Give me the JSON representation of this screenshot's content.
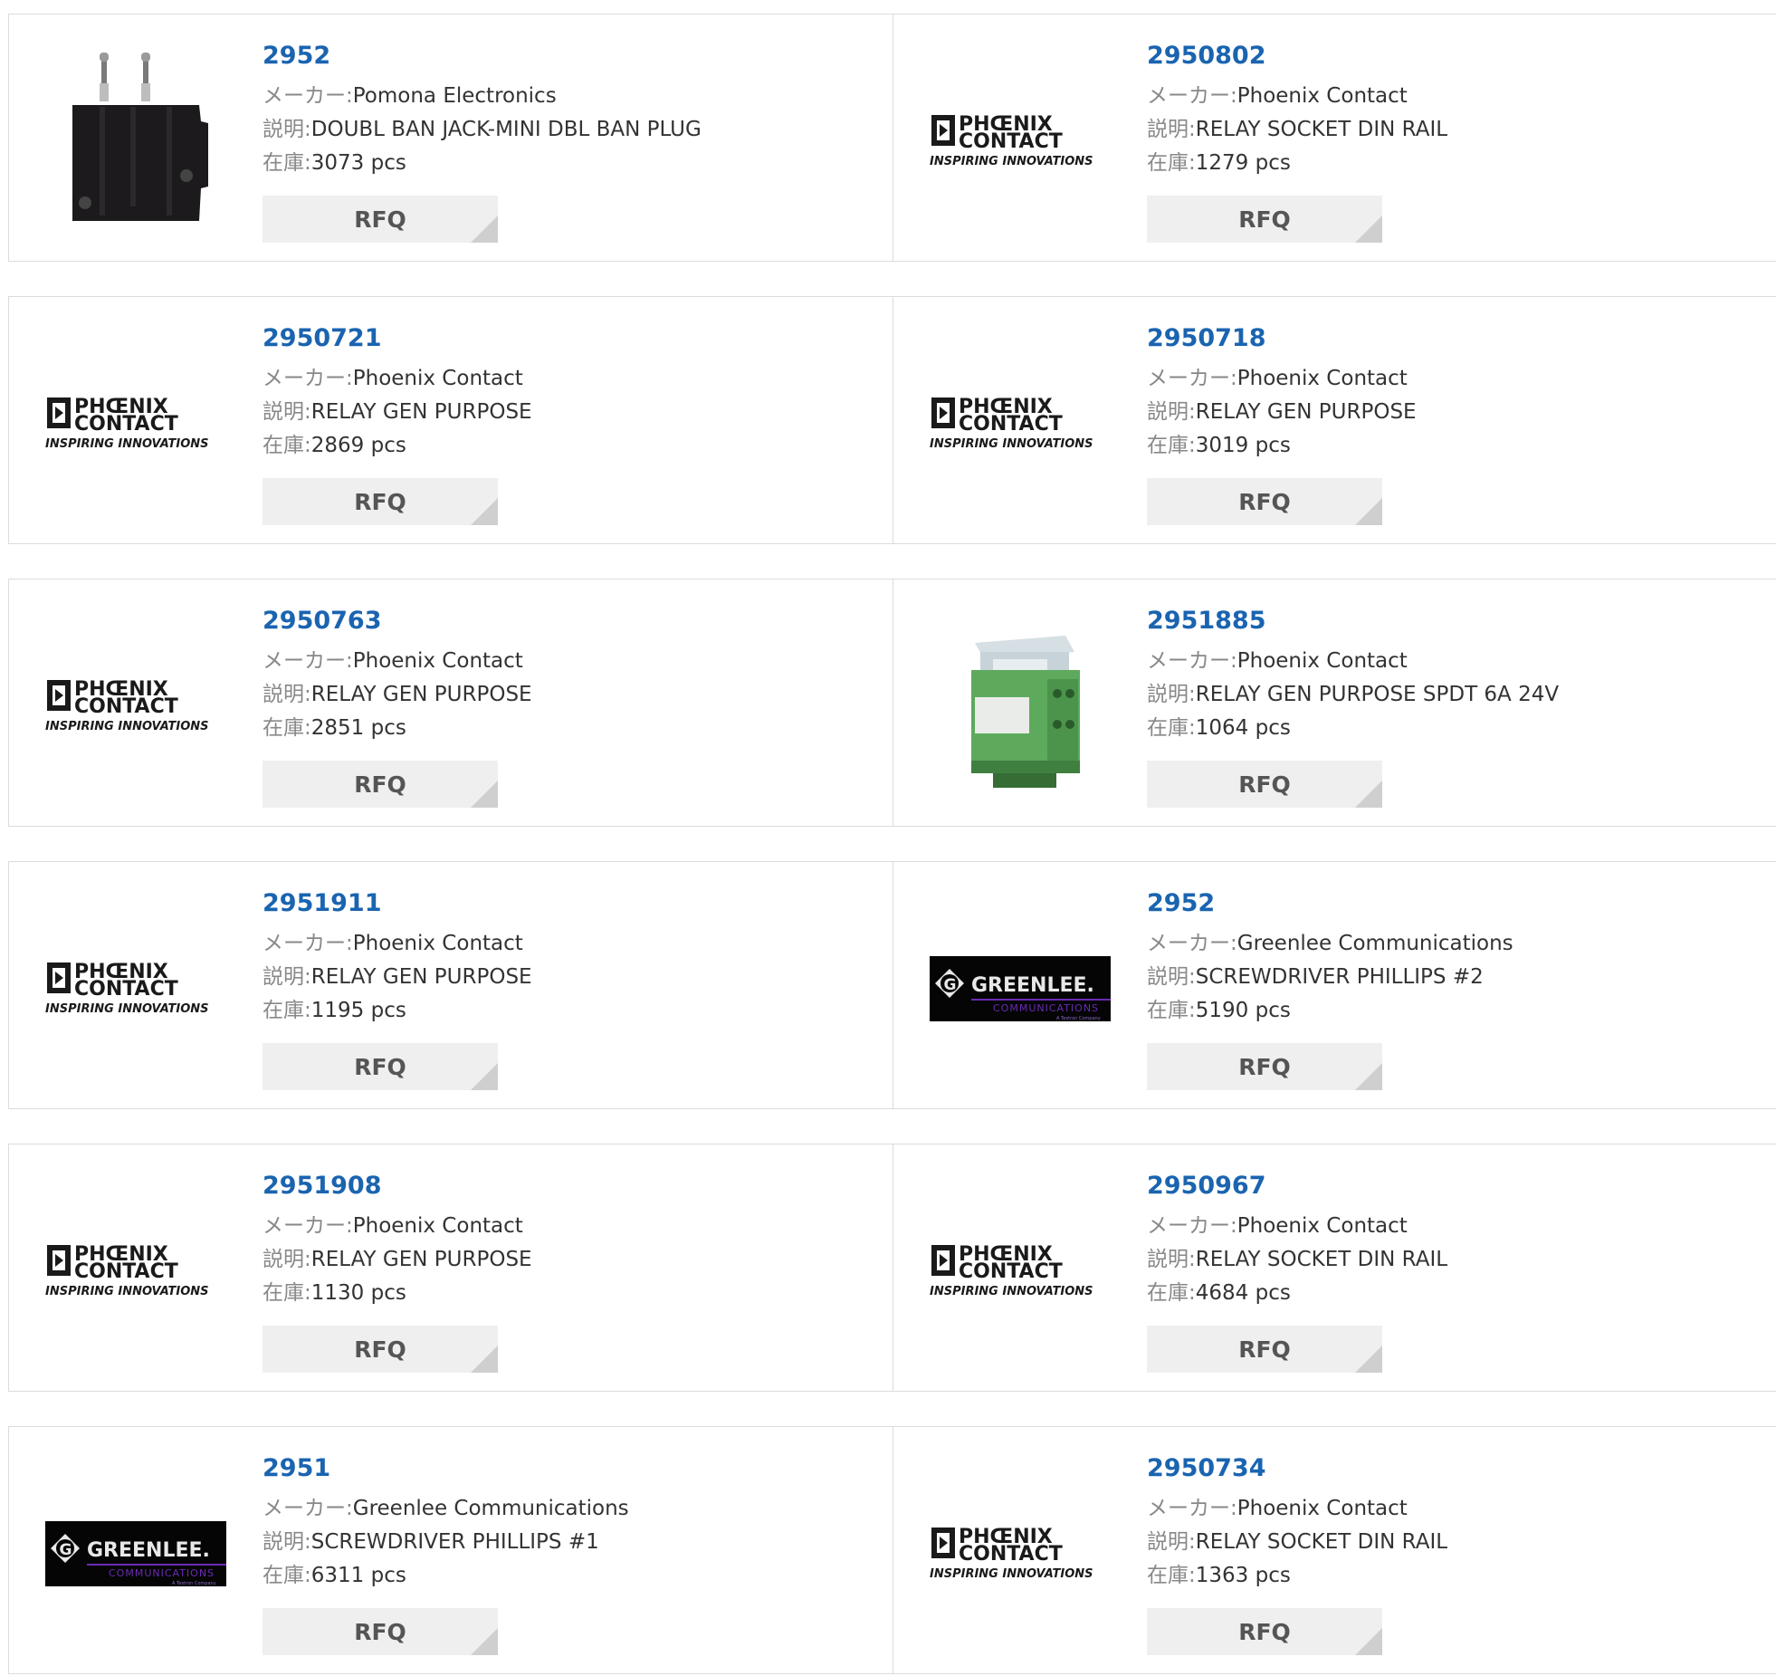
{
  "labels": {
    "maker": "メーカー:",
    "desc": "説明:",
    "stock": "在庫:",
    "rfq": "RFQ"
  },
  "products": [
    {
      "part": "2952",
      "maker": "Pomona Electronics",
      "desc": "DOUBL BAN JACK-MINI DBL BAN PLUG",
      "stock": "3073 pcs",
      "image": "banana-plug-photo"
    },
    {
      "part": "2950802",
      "maker": "Phoenix Contact",
      "desc": "RELAY SOCKET DIN RAIL",
      "stock": "1279 pcs",
      "image": "phoenix-logo"
    },
    {
      "part": "2950721",
      "maker": "Phoenix Contact",
      "desc": "RELAY GEN PURPOSE",
      "stock": "2869 pcs",
      "image": "phoenix-logo"
    },
    {
      "part": "2950718",
      "maker": "Phoenix Contact",
      "desc": "RELAY GEN PURPOSE",
      "stock": "3019 pcs",
      "image": "phoenix-logo"
    },
    {
      "part": "2950763",
      "maker": "Phoenix Contact",
      "desc": "RELAY GEN PURPOSE",
      "stock": "2851 pcs",
      "image": "phoenix-logo"
    },
    {
      "part": "2951885",
      "maker": "Phoenix Contact",
      "desc": "RELAY GEN PURPOSE SPDT 6A 24V",
      "stock": "1064 pcs",
      "image": "relay-module-photo"
    },
    {
      "part": "2951911",
      "maker": "Phoenix Contact",
      "desc": "RELAY GEN PURPOSE",
      "stock": "1195 pcs",
      "image": "phoenix-logo"
    },
    {
      "part": "2952",
      "maker": "Greenlee Communications",
      "desc": "SCREWDRIVER PHILLIPS #2",
      "stock": "5190 pcs",
      "image": "greenlee-logo"
    },
    {
      "part": "2951908",
      "maker": "Phoenix Contact",
      "desc": "RELAY GEN PURPOSE",
      "stock": "1130 pcs",
      "image": "phoenix-logo"
    },
    {
      "part": "2950967",
      "maker": "Phoenix Contact",
      "desc": "RELAY SOCKET DIN RAIL",
      "stock": "4684 pcs",
      "image": "phoenix-logo"
    },
    {
      "part": "2951",
      "maker": "Greenlee Communications",
      "desc": "SCREWDRIVER PHILLIPS #1",
      "stock": "6311 pcs",
      "image": "greenlee-logo"
    },
    {
      "part": "2950734",
      "maker": "Phoenix Contact",
      "desc": "RELAY SOCKET DIN RAIL",
      "stock": "1363 pcs",
      "image": "phoenix-logo"
    }
  ],
  "logos": {
    "phoenix": {
      "line1": "PHŒNIX",
      "line2": "CONTACT",
      "tagline": "INSPIRING INNOVATIONS"
    },
    "greenlee": {
      "name": "GREENLEE.",
      "sub": "COMMUNICATIONS",
      "tiny": "A Textron Company"
    }
  },
  "colors": {
    "part_link": "#1a64b0",
    "rfq_bg": "#efefef",
    "greenlee_purple": "#6a2bb3",
    "relay_green": "#5daa5d"
  }
}
